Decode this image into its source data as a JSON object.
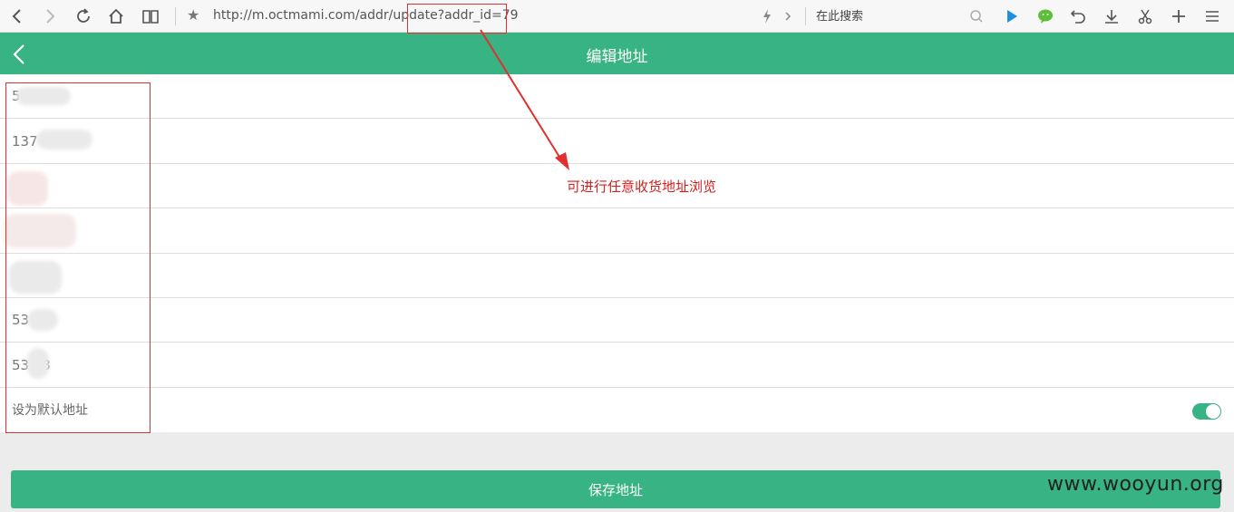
{
  "browser": {
    "url": "http://m.octmami.com/addr/update?addr_id=79",
    "search_placeholder": "在此搜索"
  },
  "header": {
    "title": "编辑地址"
  },
  "form": {
    "rows": [
      {
        "value": "5"
      },
      {
        "value": "137          9"
      },
      {
        "value": "."
      },
      {
        "value": "   "
      },
      {
        "value": " "
      },
      {
        "value": "53     3"
      },
      {
        "value": "53    43"
      }
    ],
    "default_label": "设为默认地址",
    "default_on": true
  },
  "save_label": "保存地址",
  "annotation": {
    "text": "可进行任意收货地址浏览",
    "color": "#d62020"
  },
  "watermark": "www.wooyun.org",
  "colors": {
    "accent": "#38b383"
  }
}
